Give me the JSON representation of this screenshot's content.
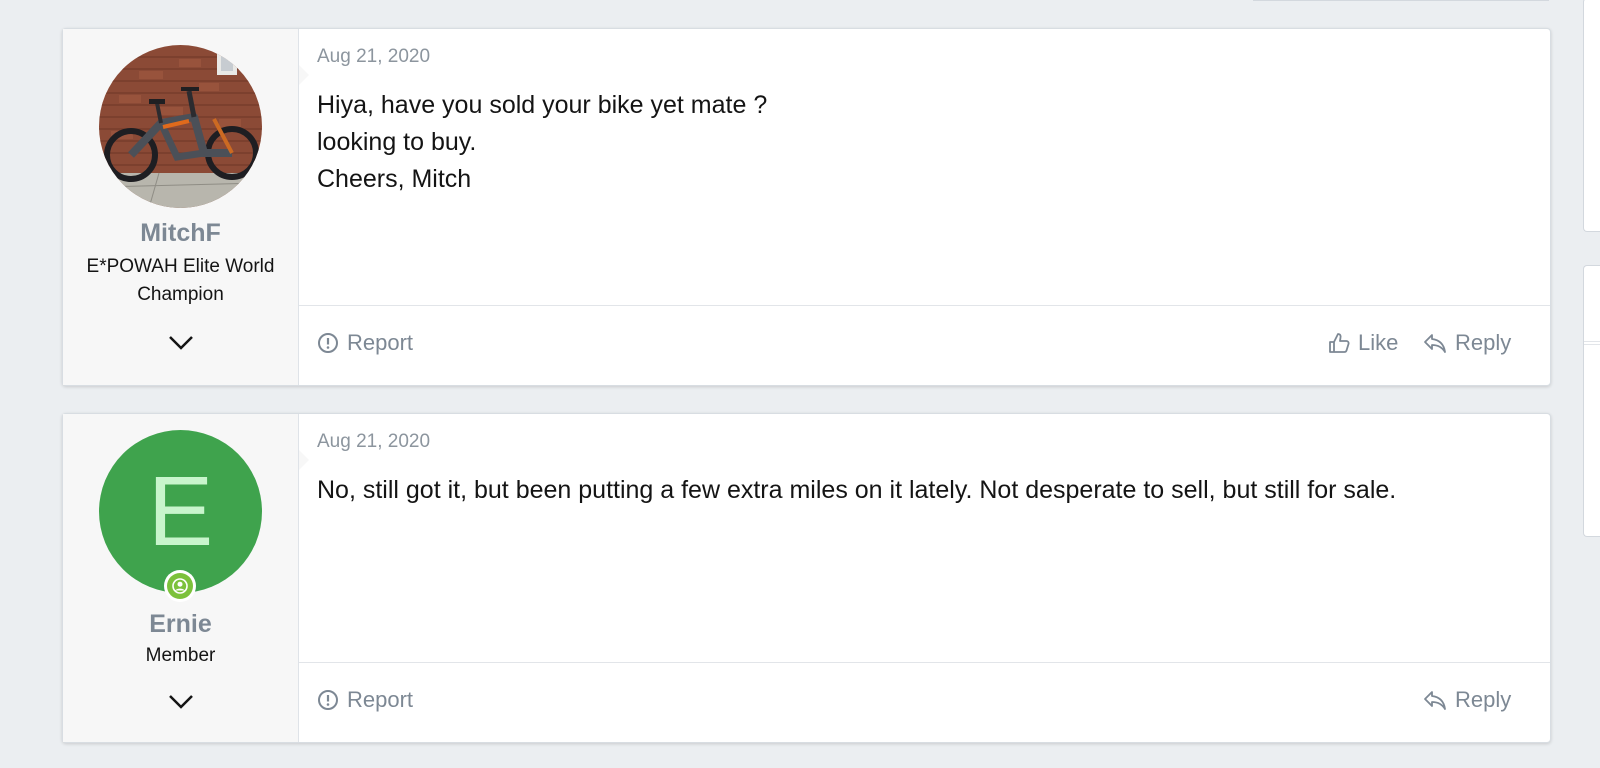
{
  "posts": [
    {
      "username": "MitchF",
      "user_title": "E*POWAH Elite World Champion",
      "date": "Aug 21, 2020",
      "body": [
        "Hiya, have you sold your bike yet mate ?",
        "looking to buy.",
        "Cheers, Mitch"
      ],
      "actions": {
        "report": "Report",
        "like": "Like",
        "reply": "Reply"
      }
    },
    {
      "username": "Ernie",
      "avatar_letter": "E",
      "user_title": "Member",
      "date": "Aug 21, 2020",
      "body": [
        "No, still got it, but been putting a few extra miles on it lately. Not desperate to sell, but still for sale."
      ],
      "actions": {
        "report": "Report",
        "reply": "Reply"
      }
    }
  ],
  "colors": {
    "background": "#ebeef1",
    "username": "#7d8894",
    "avatar_green": "#3fa34d",
    "online_badge": "#7cc13b"
  },
  "icons": [
    "report-icon",
    "like-icon",
    "reply-icon",
    "chevron-down-icon",
    "user-online-icon"
  ]
}
